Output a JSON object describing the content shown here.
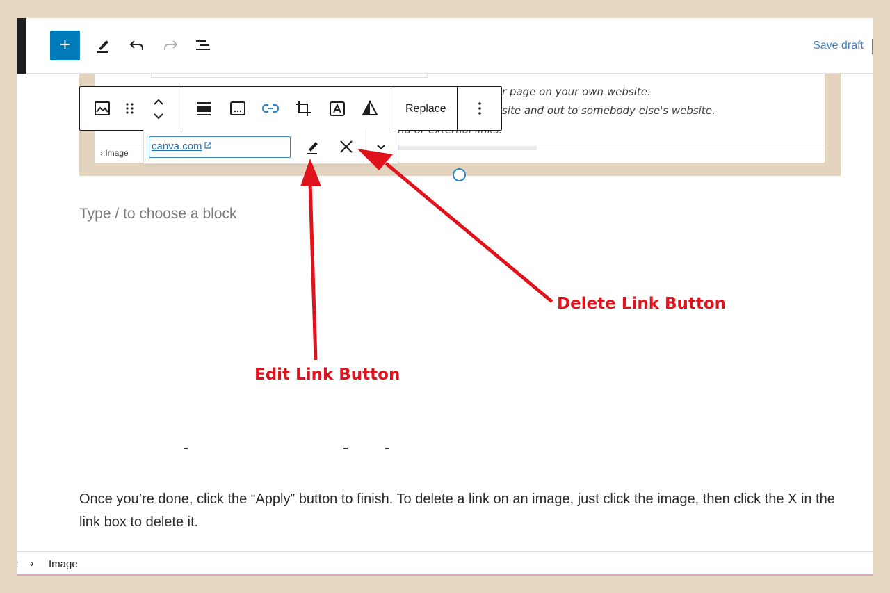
{
  "toolbar": {
    "add_label": "+",
    "save_draft": "Save draft"
  },
  "image_block": {
    "text_line_1": "r page on your own website.",
    "text_line_2": "site and out to somebody else's website.",
    "text_line_3": "nd or external links.",
    "breadcrumb": "Image"
  },
  "block_toolbar": {
    "replace_label": "Replace"
  },
  "link_popover": {
    "url": "canva.com"
  },
  "editor": {
    "placeholder": "Type / to choose a block",
    "paragraph": "Once you’re done, click the “Apply” button to finish. To delete a link on an image, just click the image, then click the X in the link box to delete it."
  },
  "breadcrumb": {
    "start": "t",
    "separator": "›",
    "current": "Image"
  },
  "annotations": {
    "delete_label": "Delete Link Button",
    "edit_label": "Edit Link Button",
    "color": "#e0121b"
  },
  "colors": {
    "accent": "#007cba",
    "link": "#2271b1",
    "background": "#e7d8c3"
  }
}
